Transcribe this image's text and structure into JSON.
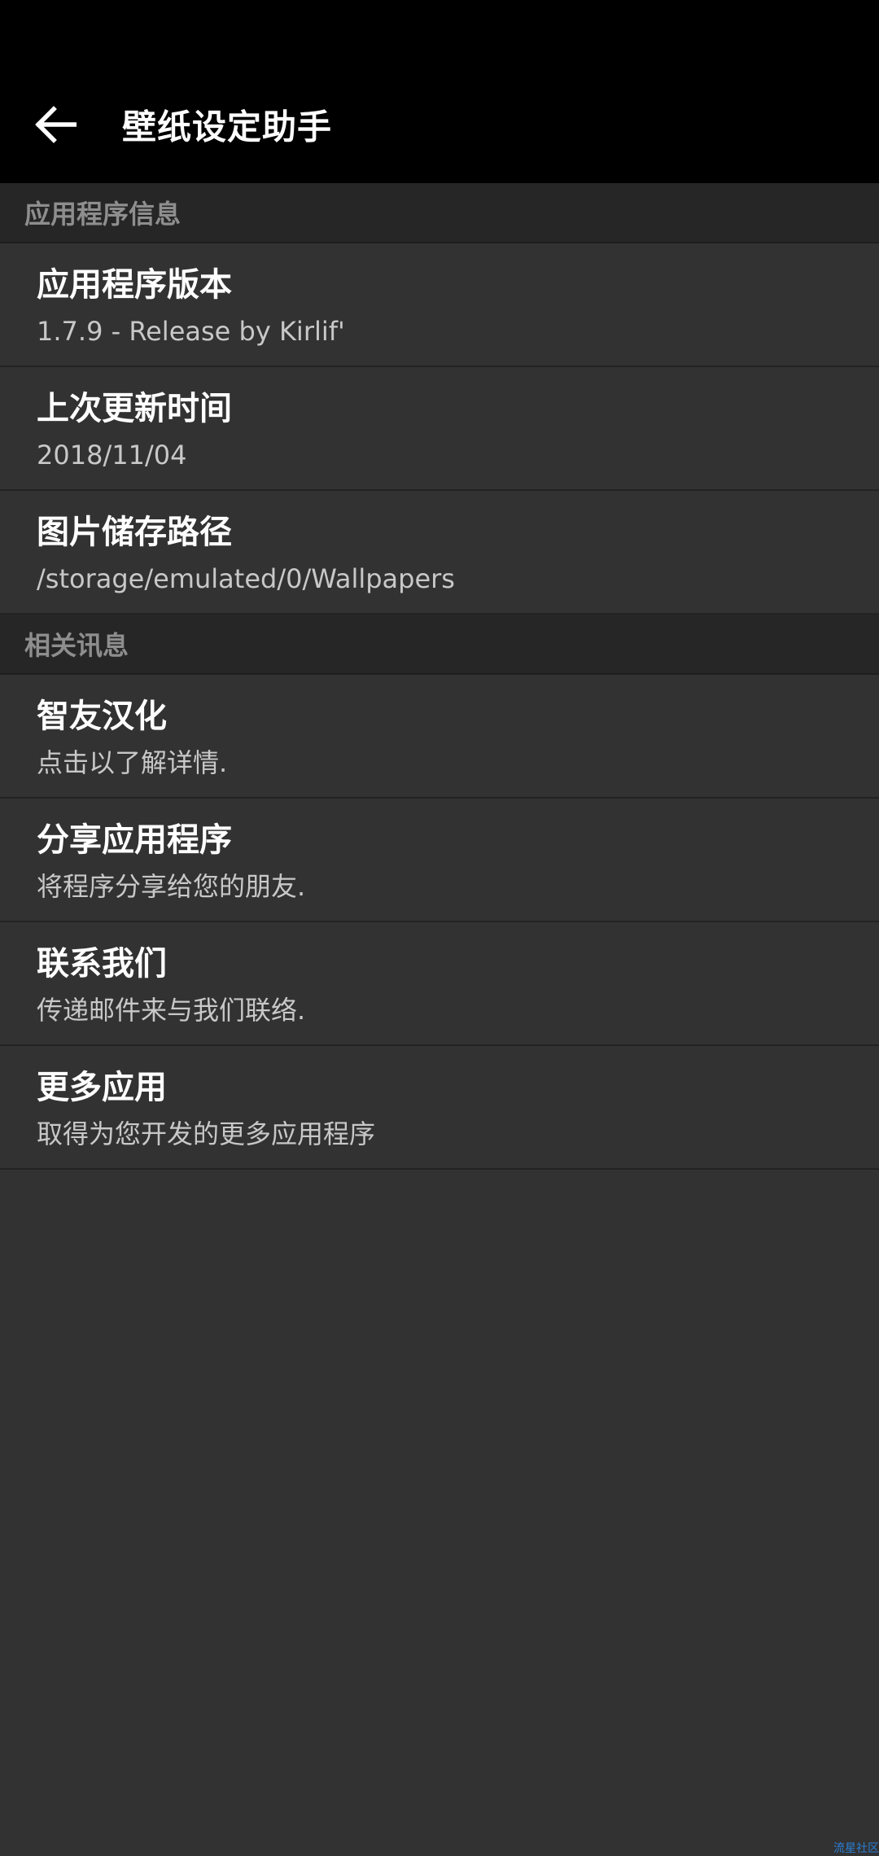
{
  "toolbar": {
    "title": "壁纸设定助手",
    "back_icon": "arrow-left-icon"
  },
  "sections": [
    {
      "header": "应用程序信息",
      "items": [
        {
          "title": "应用程序版本",
          "summary": "1.7.9 - Release by Kirlif'"
        },
        {
          "title": "上次更新时间",
          "summary": "2018/11/04"
        },
        {
          "title": "图片储存路径",
          "summary": "/storage/emulated/0/Wallpapers"
        }
      ]
    },
    {
      "header": "相关讯息",
      "items": [
        {
          "title": "智友汉化",
          "summary": "点击以了解详情."
        },
        {
          "title": "分享应用程序",
          "summary": "将程序分享给您的朋友."
        },
        {
          "title": "联系我们",
          "summary": "传递邮件来与我们联络."
        },
        {
          "title": "更多应用",
          "summary": "取得为您开发的更多应用程序"
        }
      ]
    }
  ],
  "watermark": "流星社区",
  "colors": {
    "toolbar_bg": "#000000",
    "content_bg": "#323232",
    "section_bg": "#262626",
    "title_text": "#ffffff",
    "summary_text": "#c8c8c8",
    "section_text": "#8e8e8e"
  }
}
